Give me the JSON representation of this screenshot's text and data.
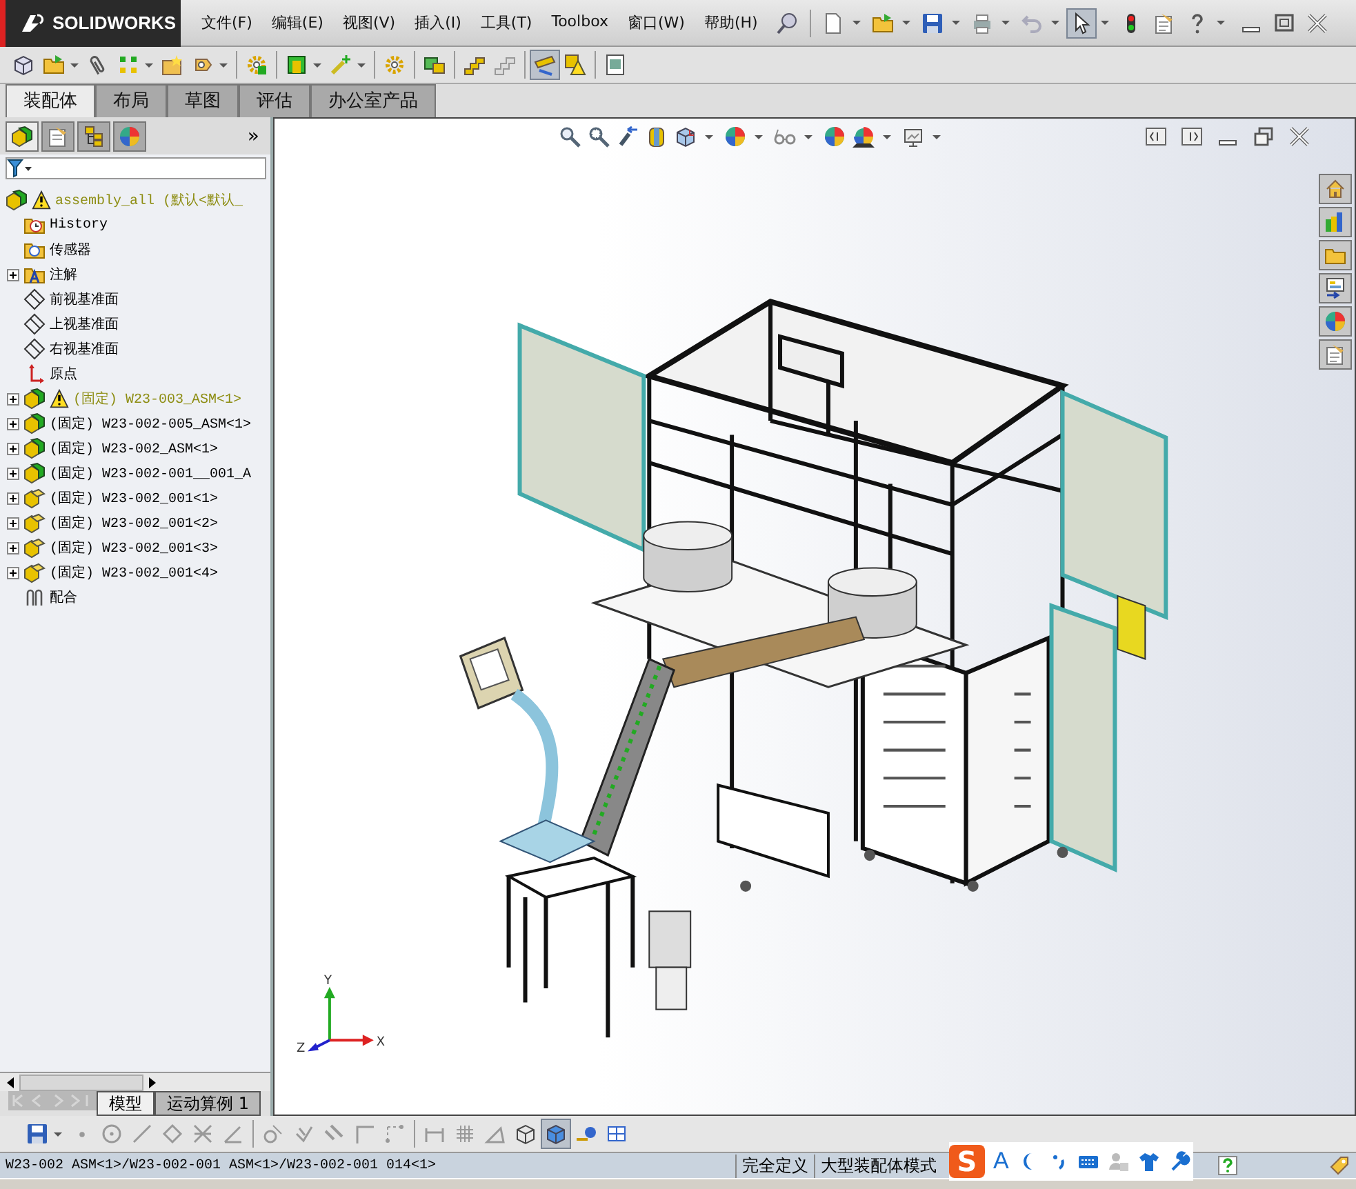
{
  "app": {
    "brand": "SOLIDWORKS"
  },
  "menu": [
    "文件(F)",
    "编辑(E)",
    "视图(V)",
    "插入(I)",
    "工具(T)",
    "Toolbox",
    "窗口(W)",
    "帮助(H)"
  ],
  "title_toolbar": [
    {
      "kind": "pin",
      "pressed": false,
      "dropdown": false
    },
    {
      "kind": "separator"
    },
    {
      "kind": "new-doc",
      "pressed": false,
      "dropdown": true
    },
    {
      "kind": "open",
      "pressed": false,
      "dropdown": true
    },
    {
      "kind": "save",
      "pressed": false,
      "dropdown": true
    },
    {
      "kind": "print",
      "pressed": false,
      "dropdown": true
    },
    {
      "kind": "undo",
      "pressed": false,
      "dropdown": true
    },
    {
      "kind": "select",
      "pressed": true,
      "dropdown": true
    },
    {
      "kind": "traffic",
      "pressed": false,
      "dropdown": false
    },
    {
      "kind": "options",
      "pressed": false,
      "dropdown": false
    },
    {
      "kind": "help",
      "pressed": false,
      "dropdown": true
    }
  ],
  "main_toolbar": [
    {
      "kind": "cube-ghost",
      "pressed": false,
      "dropdown": false
    },
    {
      "kind": "open",
      "pressed": false,
      "dropdown": true
    },
    {
      "kind": "paperclip",
      "pressed": false,
      "dropdown": false
    },
    {
      "kind": "pattern",
      "pressed": false,
      "dropdown": true
    },
    {
      "kind": "star-box",
      "pressed": false,
      "dropdown": false
    },
    {
      "kind": "move",
      "pressed": false,
      "dropdown": true
    },
    {
      "kind": "separator"
    },
    {
      "kind": "gears-box",
      "pressed": false,
      "dropdown": false
    },
    {
      "kind": "separator"
    },
    {
      "kind": "green-frame",
      "pressed": false,
      "dropdown": true
    },
    {
      "kind": "sparkle",
      "pressed": false,
      "dropdown": true
    },
    {
      "kind": "separator"
    },
    {
      "kind": "gear",
      "pressed": false,
      "dropdown": false
    },
    {
      "kind": "separator"
    },
    {
      "kind": "explode",
      "pressed": false,
      "dropdown": false
    },
    {
      "kind": "separator"
    },
    {
      "kind": "stairs",
      "pressed": false,
      "dropdown": false
    },
    {
      "kind": "stairs-grey",
      "pressed": false,
      "dropdown": false
    },
    {
      "kind": "separator"
    },
    {
      "kind": "ruler",
      "pressed": true,
      "dropdown": false
    },
    {
      "kind": "warning-box",
      "pressed": false,
      "dropdown": false
    },
    {
      "kind": "separator"
    },
    {
      "kind": "photo",
      "pressed": false,
      "dropdown": false
    }
  ],
  "tabs": [
    {
      "label": "装配体",
      "selected": true
    },
    {
      "label": "布局",
      "selected": false
    },
    {
      "label": "草图",
      "selected": false
    },
    {
      "label": "评估",
      "selected": false
    },
    {
      "label": "办公室产品",
      "selected": false
    }
  ],
  "panel_tabs": [
    {
      "kind": "feature-tree",
      "selected": true
    },
    {
      "kind": "property",
      "selected": false
    },
    {
      "kind": "config",
      "selected": false
    },
    {
      "kind": "display",
      "selected": false
    }
  ],
  "panel_more": "»",
  "tree": {
    "label": "assembly_all  (默认<默认_",
    "kind": "assembly",
    "warning": true,
    "children": [
      {
        "label": "History",
        "kind": "history",
        "warning": false
      },
      {
        "label": "传感器",
        "kind": "sensor",
        "warning": false
      },
      {
        "label": "注解",
        "kind": "annotation",
        "warning": false,
        "expanded": false
      },
      {
        "label": "前视基准面",
        "kind": "plane",
        "warning": false
      },
      {
        "label": "上视基准面",
        "kind": "plane",
        "warning": false
      },
      {
        "label": "右视基准面",
        "kind": "plane",
        "warning": false
      },
      {
        "label": "原点",
        "kind": "origin",
        "warning": false
      },
      {
        "label": "(固定) W23-003_ASM<1>",
        "kind": "assembly",
        "warning": true,
        "expanded": false
      },
      {
        "label": "(固定) W23-002-005_ASM<1>",
        "kind": "assembly",
        "warning": false,
        "expanded": false
      },
      {
        "label": "(固定) W23-002_ASM<1>",
        "kind": "assembly",
        "warning": false,
        "expanded": false
      },
      {
        "label": "(固定) W23-002-001__001_A",
        "kind": "assembly",
        "warning": false,
        "expanded": false
      },
      {
        "label": "(固定) W23-002_001<1>",
        "kind": "part",
        "warning": false,
        "expanded": false
      },
      {
        "label": "(固定) W23-002_001<2>",
        "kind": "part",
        "warning": false,
        "expanded": false
      },
      {
        "label": "(固定) W23-002_001<3>",
        "kind": "part",
        "warning": false,
        "expanded": false
      },
      {
        "label": "(固定) W23-002_001<4>",
        "kind": "part",
        "warning": false,
        "expanded": false
      },
      {
        "label": "配合",
        "kind": "mates",
        "warning": false
      }
    ]
  },
  "model_tabs": [
    {
      "label": "模型",
      "selected": true
    },
    {
      "label": "运动算例 1",
      "selected": false
    }
  ],
  "headsup_toolbar": [
    {
      "kind": "zoom-fit",
      "dropdown": false
    },
    {
      "kind": "zoom-area",
      "dropdown": false
    },
    {
      "kind": "prev-view",
      "dropdown": false
    },
    {
      "kind": "section",
      "dropdown": false
    },
    {
      "kind": "orient",
      "dropdown": true
    },
    {
      "kind": "display",
      "dropdown": true
    },
    {
      "kind": "glasses",
      "dropdown": true
    },
    {
      "kind": "ball",
      "dropdown": false
    },
    {
      "kind": "scene",
      "dropdown": true
    },
    {
      "kind": "monitor",
      "dropdown": true
    }
  ],
  "task_pane": [
    {
      "kind": "home"
    },
    {
      "kind": "books"
    },
    {
      "kind": "folder"
    },
    {
      "kind": "explorer"
    },
    {
      "kind": "ball"
    },
    {
      "kind": "options"
    }
  ],
  "triad": {
    "x": "X",
    "y": "Y",
    "z": "Z"
  },
  "sketch_toolbar": [
    {
      "kind": "save",
      "pressed": false,
      "dropdown": true
    },
    {
      "kind": "point",
      "pressed": false,
      "dropdown": false
    },
    {
      "kind": "circle",
      "pressed": false,
      "dropdown": false
    },
    {
      "kind": "line",
      "pressed": false,
      "dropdown": false
    },
    {
      "kind": "polygon",
      "pressed": false,
      "dropdown": false
    },
    {
      "kind": "trim",
      "pressed": false,
      "dropdown": false
    },
    {
      "kind": "angle-line",
      "pressed": false,
      "dropdown": false
    },
    {
      "kind": "separator"
    },
    {
      "kind": "fillet",
      "pressed": false,
      "dropdown": false
    },
    {
      "kind": "offset",
      "pressed": false,
      "dropdown": false
    },
    {
      "kind": "parallel",
      "pressed": false,
      "dropdown": false
    },
    {
      "kind": "corner",
      "pressed": false,
      "dropdown": false
    },
    {
      "kind": "dots-line",
      "pressed": false,
      "dropdown": false
    },
    {
      "kind": "separator"
    },
    {
      "kind": "dimension",
      "pressed": false,
      "dropdown": false
    },
    {
      "kind": "grid",
      "pressed": false,
      "dropdown": false
    },
    {
      "kind": "triangle",
      "pressed": false,
      "dropdown": false
    },
    {
      "kind": "wire-cube",
      "pressed": false,
      "dropdown": false
    },
    {
      "kind": "shaded-cube",
      "pressed": true,
      "dropdown": false
    },
    {
      "kind": "key",
      "pressed": false,
      "dropdown": false
    },
    {
      "kind": "table",
      "pressed": false,
      "dropdown": false
    }
  ],
  "status_bar": {
    "path": "W23-002 ASM<1>/W23-002-001 ASM<1>/W23-002-001 014<1>",
    "cells": [
      "完全定义",
      "大型装配体模式"
    ]
  },
  "ime": {
    "logo": "S",
    "mode": "A"
  }
}
